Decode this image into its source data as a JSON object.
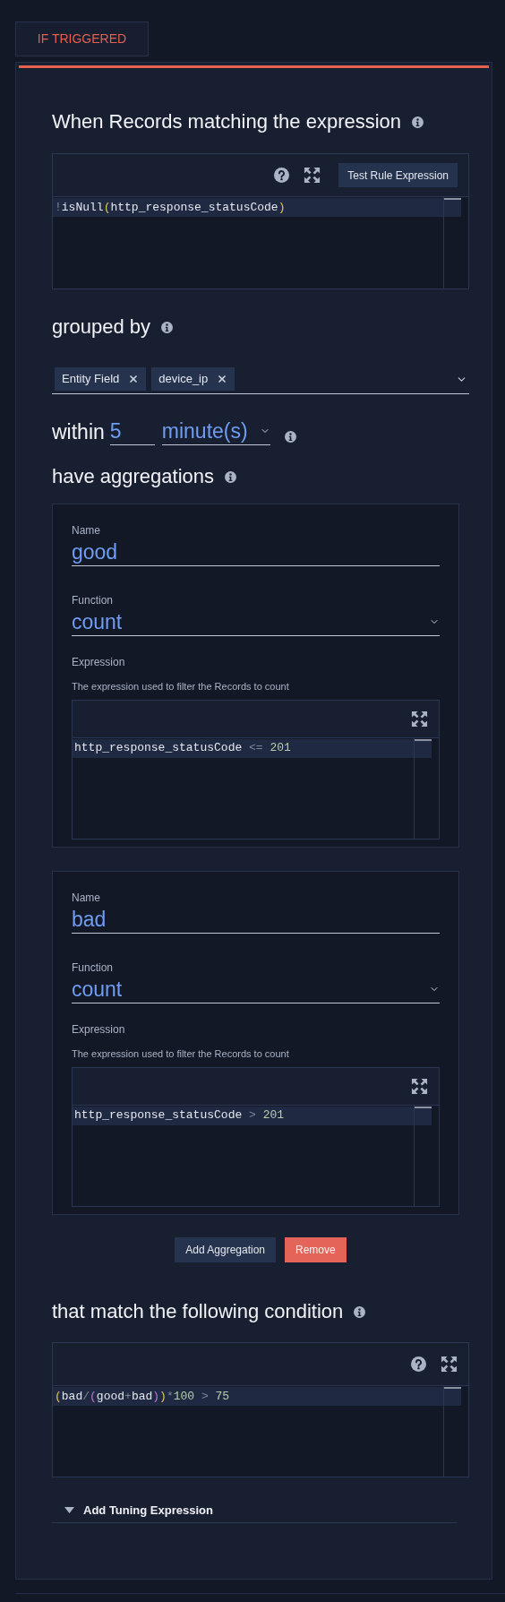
{
  "tab": {
    "label": "IF TRIGGERED",
    "selected": true
  },
  "match": {
    "heading": "When Records matching the expression",
    "editor": {
      "help": true,
      "test_button": "Test Rule Expression",
      "code": [
        {
          "text": "!",
          "kind": "operator"
        },
        {
          "text": "isNull",
          "kind": "identifier"
        },
        {
          "text": "(",
          "kind": "bracket"
        },
        {
          "text": "http_response_statusCode",
          "kind": "identifier"
        },
        {
          "text": ")",
          "kind": "bracket"
        }
      ]
    }
  },
  "group_by": {
    "heading": "grouped by",
    "chips": [
      "Entity Field",
      "device_ip"
    ]
  },
  "within": {
    "label": "within",
    "value": "5",
    "unit": "minute(s)"
  },
  "aggregations": {
    "heading": "have aggregations",
    "items": [
      {
        "name_label": "Name",
        "name": "good",
        "function_label": "Function",
        "function": "count",
        "expression_label": "Expression",
        "expression_hint": "The expression used to filter the Records to count",
        "editor": {
          "help": false,
          "code": [
            {
              "text": "http_response_statusCode",
              "kind": "identifier"
            },
            {
              "text": " <= ",
              "kind": "operator"
            },
            {
              "text": "201",
              "kind": "number"
            }
          ]
        }
      },
      {
        "name_label": "Name",
        "name": "bad",
        "function_label": "Function",
        "function": "count",
        "expression_label": "Expression",
        "expression_hint": "The expression used to filter the Records to count",
        "editor": {
          "help": false,
          "code": [
            {
              "text": "http_response_statusCode",
              "kind": "identifier"
            },
            {
              "text": " > ",
              "kind": "operator"
            },
            {
              "text": "201",
              "kind": "number"
            }
          ]
        }
      }
    ]
  },
  "buttons": [
    {
      "label": "Add Aggregation",
      "kind": "secondary"
    },
    {
      "label": "Remove",
      "kind": "danger"
    }
  ],
  "condition": {
    "heading": "that match the following condition",
    "editor": {
      "help": true,
      "code": [
        {
          "text": "(",
          "kind": "bracket"
        },
        {
          "text": "bad",
          "kind": "identifier"
        },
        {
          "text": "/",
          "kind": "operator"
        },
        {
          "text": "(",
          "kind": "bracket_nested"
        },
        {
          "text": "good",
          "kind": "identifier"
        },
        {
          "text": "+",
          "kind": "operator"
        },
        {
          "text": "bad",
          "kind": "identifier"
        },
        {
          "text": ")",
          "kind": "bracket_nested"
        },
        {
          "text": ")",
          "kind": "bracket"
        },
        {
          "text": "*",
          "kind": "operator"
        },
        {
          "text": "100",
          "kind": "number"
        },
        {
          "text": " > ",
          "kind": "operator"
        },
        {
          "text": "75",
          "kind": "number"
        }
      ]
    }
  },
  "tuning": {
    "label": "Add Tuning Expression",
    "expanded": false
  }
}
